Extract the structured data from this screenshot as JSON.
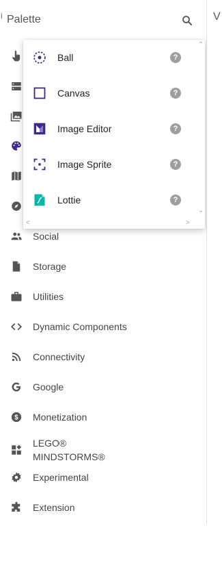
{
  "palette": {
    "title": "Palette",
    "info_mark": "i",
    "categories": [
      {
        "label": "",
        "icon": "touch-icon"
      },
      {
        "label": "",
        "icon": "storage-rows-icon"
      },
      {
        "label": "",
        "icon": "media-icon"
      },
      {
        "label": "",
        "icon": "palette-icon"
      },
      {
        "label": "",
        "icon": "map-icon"
      },
      {
        "label": "",
        "icon": "compass-icon"
      },
      {
        "label": "Social",
        "icon": "people-icon"
      },
      {
        "label": "Storage",
        "icon": "file-icon"
      },
      {
        "label": "Utilities",
        "icon": "briefcase-icon"
      },
      {
        "label": "Dynamic Components",
        "icon": "code-icon"
      },
      {
        "label": "Connectivity",
        "icon": "rss-icon"
      },
      {
        "label": "Google",
        "icon": "google-icon"
      },
      {
        "label": "Monetization",
        "icon": "dollar-icon"
      },
      {
        "label": "LEGO®\nMINDSTORMS®",
        "icon": "lego-icon"
      },
      {
        "label": "Experimental",
        "icon": "gear-icon"
      },
      {
        "label": "Extension",
        "icon": "puzzle-icon"
      }
    ]
  },
  "drawing_components": [
    {
      "label": "Ball",
      "icon": "ball-icon",
      "help": "?"
    },
    {
      "label": "Canvas",
      "icon": "canvas-icon",
      "help": "?"
    },
    {
      "label": "Image Editor",
      "icon": "image-editor-icon",
      "help": "?"
    },
    {
      "label": "Image Sprite",
      "icon": "image-sprite-icon",
      "help": "?"
    },
    {
      "label": "Lottie",
      "icon": "lottie-icon",
      "help": "?"
    }
  ],
  "viewer": {
    "label": "V"
  },
  "colors": {
    "accent": "#3f2a8c",
    "lottie": "#00b8a9",
    "icon_gray": "#555555",
    "help_gray": "#9e9e9e"
  }
}
